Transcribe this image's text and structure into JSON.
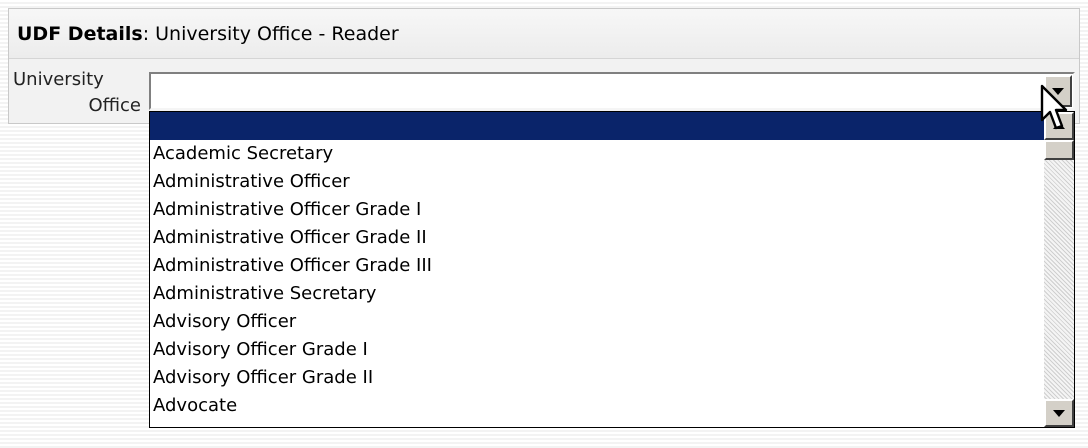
{
  "panel": {
    "title_bold": "UDF Details",
    "title_rest": ": University Office - Reader"
  },
  "field": {
    "label_line1": "University",
    "label_line2": "Office",
    "value": ""
  },
  "dropdown": {
    "selected_index": 0,
    "options": [
      "",
      "Academic Secretary",
      "Administrative Officer",
      "Administrative Officer Grade I",
      "Administrative Officer Grade II",
      "Administrative Officer Grade III",
      "Administrative Secretary",
      "Advisory Officer",
      "Advisory Officer Grade I",
      "Advisory Officer Grade II",
      "Advocate"
    ]
  },
  "colors": {
    "selection": "#0a246a",
    "panel_background": "#f2f2f2"
  },
  "icons": [
    "dropdown-arrow-icon",
    "scroll-up-arrow-icon",
    "scroll-down-arrow-icon",
    "mouse-cursor-icon"
  ]
}
